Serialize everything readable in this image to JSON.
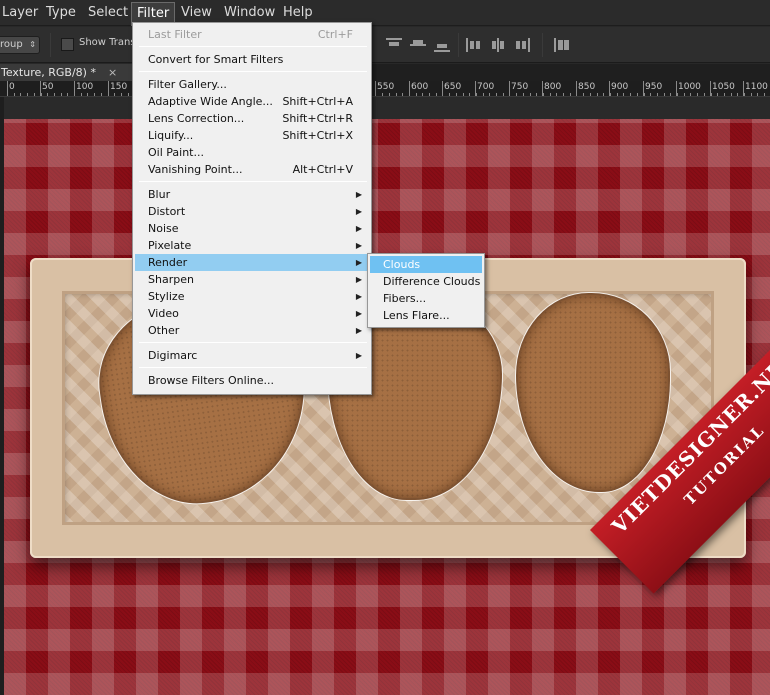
{
  "menubar": {
    "items": [
      {
        "label": "Layer",
        "active": false
      },
      {
        "label": "Type",
        "active": false
      },
      {
        "label": "Select",
        "active": false
      },
      {
        "label": "Filter",
        "active": true
      },
      {
        "label": "View",
        "active": false
      },
      {
        "label": "Window",
        "active": false
      },
      {
        "label": "Help",
        "active": false
      }
    ]
  },
  "options_bar": {
    "autoselect_value": "roup",
    "show_transform_label": "Show Trans"
  },
  "document": {
    "tab_title": "Texture, RGB/8) *",
    "close_glyph": "×"
  },
  "ruler": {
    "labels": [
      "0",
      "50",
      "100",
      "150",
      "550",
      "600",
      "650",
      "700",
      "750",
      "800",
      "850",
      "900",
      "950",
      "1000",
      "1050",
      "1100"
    ]
  },
  "filter_menu": {
    "items": [
      {
        "label": "Last Filter",
        "shortcut": "Ctrl+F",
        "disabled": true
      },
      {
        "sep": true
      },
      {
        "label": "Convert for Smart Filters"
      },
      {
        "sep": true
      },
      {
        "label": "Filter Gallery..."
      },
      {
        "label": "Adaptive Wide Angle...",
        "shortcut": "Shift+Ctrl+A"
      },
      {
        "label": "Lens Correction...",
        "shortcut": "Shift+Ctrl+R"
      },
      {
        "label": "Liquify...",
        "shortcut": "Shift+Ctrl+X"
      },
      {
        "label": "Oil Paint..."
      },
      {
        "label": "Vanishing Point...",
        "shortcut": "Alt+Ctrl+V"
      },
      {
        "sep": true
      },
      {
        "label": "Blur",
        "submenu": true
      },
      {
        "label": "Distort",
        "submenu": true
      },
      {
        "label": "Noise",
        "submenu": true
      },
      {
        "label": "Pixelate",
        "submenu": true
      },
      {
        "label": "Render",
        "submenu": true,
        "highlighted": true
      },
      {
        "label": "Sharpen",
        "submenu": true
      },
      {
        "label": "Stylize",
        "submenu": true
      },
      {
        "label": "Video",
        "submenu": true
      },
      {
        "label": "Other",
        "submenu": true
      },
      {
        "sep": true
      },
      {
        "label": "Digimarc",
        "submenu": true
      },
      {
        "sep": true
      },
      {
        "label": "Browse Filters Online..."
      }
    ]
  },
  "render_submenu": {
    "items": [
      {
        "label": "Clouds",
        "highlighted": true
      },
      {
        "label": "Difference Clouds"
      },
      {
        "label": "Fibers..."
      },
      {
        "label": "Lens Flare..."
      }
    ]
  },
  "watermark": {
    "title": "VIETDESIGNER.NET",
    "subtitle": "TUTORIAL"
  },
  "colors": {
    "menu_bg": "#f0f0f0",
    "menu_highlight": "#92cdf1",
    "submenu_highlight": "#6fc1f2",
    "canvas_red": "#8a0d16",
    "cookie_brown": "#a67044"
  }
}
